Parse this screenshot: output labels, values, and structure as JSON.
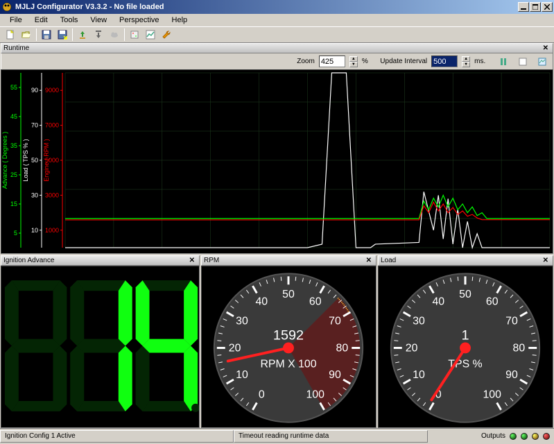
{
  "window": {
    "title": "MJLJ Configurator V3.3.2 - No file loaded"
  },
  "menu": {
    "file": "File",
    "edit": "Edit",
    "tools": "Tools",
    "view": "View",
    "perspective": "Perspective",
    "help": "Help"
  },
  "runtime": {
    "title": "Runtime",
    "zoom_label": "Zoom",
    "zoom_value": "425",
    "zoom_unit": "%",
    "interval_label": "Update Interval",
    "interval_value": "500",
    "interval_unit": "ms."
  },
  "chart_data": {
    "type": "line",
    "xrange": [
      0,
      100
    ],
    "axes": [
      {
        "name": "Advance ( Degrees )",
        "color": "#00ff00",
        "ticks": [
          5,
          15,
          25,
          35,
          45,
          55
        ],
        "range": [
          0,
          60
        ]
      },
      {
        "name": "Load ( TPS % )",
        "color": "#ffffff",
        "ticks": [
          10,
          30,
          50,
          70,
          90
        ],
        "range": [
          0,
          100
        ]
      },
      {
        "name": "Engine ( RPM )",
        "color": "#ff0000",
        "ticks": [
          1000,
          3000,
          5000,
          7000,
          9000
        ],
        "range": [
          0,
          10000
        ]
      }
    ],
    "series": [
      {
        "name": "Load (TPS %)",
        "axis": 1,
        "color": "#ffffff",
        "points": [
          [
            0,
            0
          ],
          [
            50,
            0
          ],
          [
            53,
            2
          ],
          [
            55,
            100
          ],
          [
            58,
            100
          ],
          [
            60,
            0
          ],
          [
            63,
            0
          ],
          [
            64,
            2
          ],
          [
            73,
            3
          ],
          [
            74,
            32
          ],
          [
            76,
            10
          ],
          [
            77,
            30
          ],
          [
            78,
            5
          ],
          [
            79,
            28
          ],
          [
            80,
            2
          ],
          [
            81,
            22
          ],
          [
            82,
            0
          ],
          [
            83,
            15
          ],
          [
            84,
            0
          ],
          [
            85,
            8
          ],
          [
            86,
            0
          ],
          [
            100,
            0
          ]
        ]
      },
      {
        "name": "Advance (Deg)",
        "axis": 0,
        "color": "#00ff00",
        "points": [
          [
            0,
            10
          ],
          [
            73,
            10
          ],
          [
            74,
            16
          ],
          [
            75,
            13
          ],
          [
            76,
            17
          ],
          [
            77,
            14
          ],
          [
            78,
            18
          ],
          [
            79,
            14
          ],
          [
            80,
            17
          ],
          [
            81,
            13
          ],
          [
            82,
            15
          ],
          [
            83,
            12
          ],
          [
            84,
            14
          ],
          [
            85,
            11
          ],
          [
            86,
            12
          ],
          [
            87,
            10
          ],
          [
            100,
            10
          ]
        ]
      },
      {
        "name": "Engine (RPM)",
        "axis": 2,
        "color": "#ff0000",
        "points": [
          [
            0,
            1590
          ],
          [
            73,
            1590
          ],
          [
            74,
            2400
          ],
          [
            75,
            2000
          ],
          [
            76,
            2600
          ],
          [
            77,
            2100
          ],
          [
            78,
            2500
          ],
          [
            79,
            2000
          ],
          [
            80,
            2300
          ],
          [
            81,
            1900
          ],
          [
            82,
            2100
          ],
          [
            83,
            1800
          ],
          [
            84,
            1900
          ],
          [
            85,
            1700
          ],
          [
            86,
            1600
          ],
          [
            100,
            1600
          ]
        ]
      }
    ]
  },
  "gauges": {
    "advance": {
      "title": "Ignition Advance",
      "value": "14"
    },
    "rpm": {
      "title": "RPM",
      "value": "1592",
      "label": "RPM X 100",
      "min": 0,
      "max": 100,
      "redline": 65,
      "ticks": [
        0,
        10,
        20,
        30,
        40,
        50,
        60,
        70,
        80,
        90,
        100
      ]
    },
    "load": {
      "title": "Load",
      "value": "1",
      "label": "TPS %",
      "min": 0,
      "max": 100,
      "ticks": [
        0,
        10,
        20,
        30,
        40,
        50,
        60,
        70,
        80,
        90,
        100
      ]
    }
  },
  "status": {
    "left": "Ignition Config 1 Active",
    "mid": "Timeout reading runtime data",
    "outputs": "Outputs"
  }
}
